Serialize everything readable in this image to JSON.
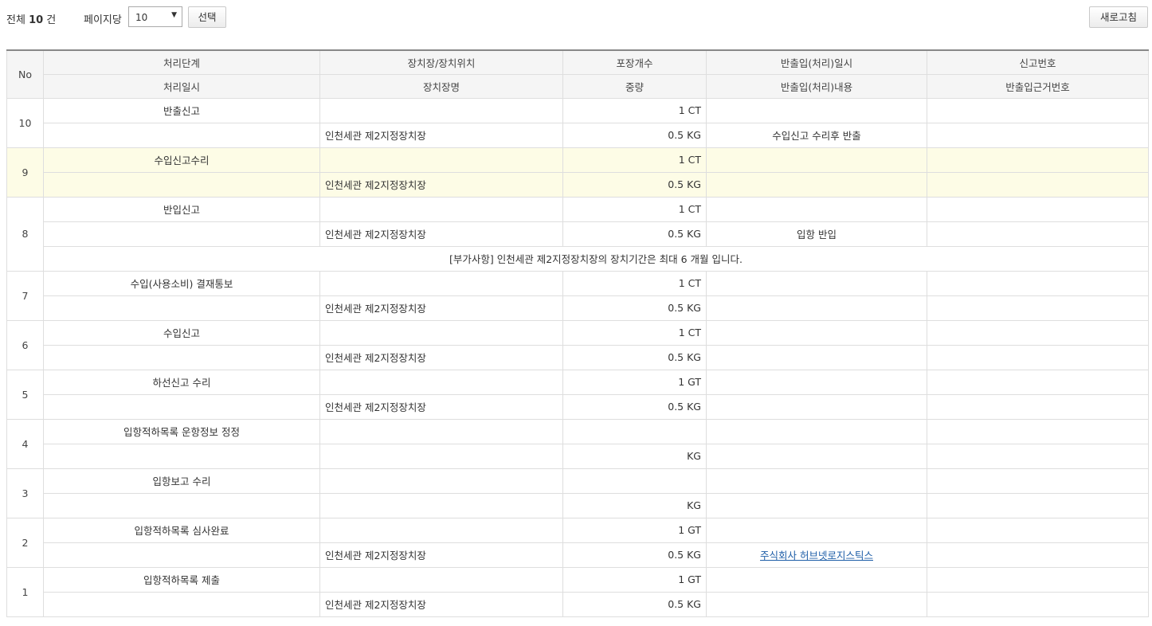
{
  "toolbar": {
    "total_prefix": "전체",
    "total_count": "10",
    "total_suffix": "건",
    "per_page_label": "페이지당",
    "per_page_value": "10",
    "select_button": "선택",
    "refresh_button": "새로고침"
  },
  "table": {
    "header_no": "No",
    "header_row1": [
      "처리단계",
      "장치장/장치위치",
      "포장개수",
      "반출입(처리)일시",
      "신고번호"
    ],
    "header_row2": [
      "처리일시",
      "장치장명",
      "중량",
      "반출입(처리)내용",
      "반출입근거번호"
    ],
    "rows": [
      {
        "no": "10",
        "stage": "반출신고",
        "location": "",
        "packages": "1 CT",
        "io_datetime": "",
        "report_no": "",
        "proc_datetime": "",
        "warehouse": "인천세관 제2지정장치장",
        "weight": "0.5 KG",
        "io_content": "수입신고 수리후 반출",
        "basis_no": ""
      },
      {
        "no": "9",
        "stage": "수입신고수리",
        "location": "",
        "packages": "1 CT",
        "io_datetime": "",
        "report_no": "",
        "proc_datetime": "",
        "warehouse": "인천세관 제2지정장치장",
        "weight": "0.5 KG",
        "io_content": "",
        "basis_no": ""
      },
      {
        "no": "8",
        "stage": "반입신고",
        "location": "",
        "packages": "1 CT",
        "io_datetime": "",
        "report_no": "",
        "proc_datetime": "",
        "warehouse": "인천세관 제2지정장치장",
        "weight": "0.5 KG",
        "io_content": "입항 반입",
        "basis_no": "",
        "note": "[부가사항] 인천세관 제2지정장치장의 장치기간은 최대 6 개월 입니다."
      },
      {
        "no": "7",
        "stage": "수입(사용소비) 결재통보",
        "location": "",
        "packages": "1 CT",
        "io_datetime": "",
        "report_no": "",
        "proc_datetime": "",
        "warehouse": "인천세관 제2지정장치장",
        "weight": "0.5 KG",
        "io_content": "",
        "basis_no": ""
      },
      {
        "no": "6",
        "stage": "수입신고",
        "location": "",
        "packages": "1 CT",
        "io_datetime": "",
        "report_no": "",
        "proc_datetime": "",
        "warehouse": "인천세관 제2지정장치장",
        "weight": "0.5 KG",
        "io_content": "",
        "basis_no": ""
      },
      {
        "no": "5",
        "stage": "하선신고 수리",
        "location": "",
        "packages": "1 GT",
        "io_datetime": "",
        "report_no": "",
        "proc_datetime": "",
        "warehouse": "인천세관 제2지정장치장",
        "weight": "0.5 KG",
        "io_content": "",
        "basis_no": ""
      },
      {
        "no": "4",
        "stage": "입항적하목록 운항정보 정정",
        "location": "",
        "packages": "",
        "io_datetime": "",
        "report_no": "",
        "proc_datetime": "",
        "warehouse": "",
        "weight": "KG",
        "io_content": "",
        "basis_no": ""
      },
      {
        "no": "3",
        "stage": "입항보고 수리",
        "location": "",
        "packages": "",
        "io_datetime": "",
        "report_no": "",
        "proc_datetime": "",
        "warehouse": "",
        "weight": "KG",
        "io_content": "",
        "basis_no": ""
      },
      {
        "no": "2",
        "stage": "입항적하목록 심사완료",
        "location": "",
        "packages": "1 GT",
        "io_datetime": "",
        "report_no": "",
        "proc_datetime": "",
        "warehouse": "인천세관 제2지정장치장",
        "weight": "0.5 KG",
        "io_content": "주식회사 허브넷로지스틱스",
        "basis_no": ""
      },
      {
        "no": "1",
        "stage": "입항적하목록 제출",
        "location": "",
        "packages": "1 GT",
        "io_datetime": "",
        "report_no": "",
        "proc_datetime": "",
        "warehouse": "인천세관 제2지정장치장",
        "weight": "0.5 KG",
        "io_content": "",
        "basis_no": ""
      }
    ]
  }
}
